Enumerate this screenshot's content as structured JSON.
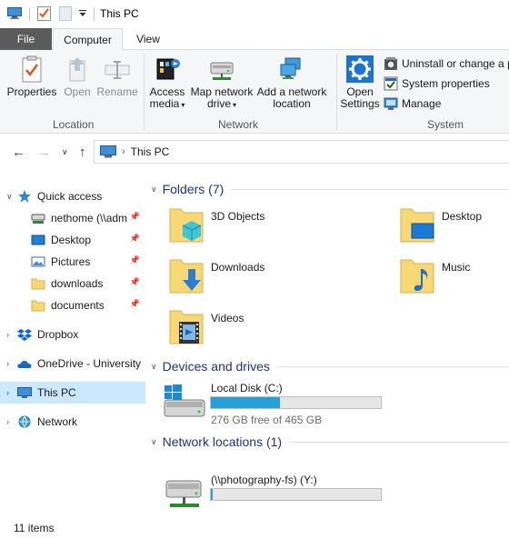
{
  "window": {
    "title": "This PC"
  },
  "ribbon_tabs": {
    "file": "File",
    "computer": "Computer",
    "view": "View"
  },
  "ribbon": {
    "location": {
      "label": "Location",
      "properties": "Properties",
      "open": "Open",
      "rename": "Rename"
    },
    "network": {
      "label": "Network",
      "access_media": [
        "Access",
        "media"
      ],
      "map_network_drive": [
        "Map network",
        "drive"
      ],
      "add_network_location": [
        "Add a network",
        "location"
      ]
    },
    "system": {
      "label": "System",
      "open_settings": [
        "Open",
        "Settings"
      ],
      "uninstall": "Uninstall or change a p",
      "system_properties": "System properties",
      "manage": "Manage"
    }
  },
  "address": {
    "path": "This PC",
    "separator": "›"
  },
  "nav_pane": {
    "quick_access": "Quick access",
    "quick_items": [
      {
        "label": "nethome (\\\\adm",
        "icon": "network-drive-icon"
      },
      {
        "label": "Desktop",
        "icon": "desktop-icon"
      },
      {
        "label": "Pictures",
        "icon": "pictures-icon"
      },
      {
        "label": "downloads",
        "icon": "folder-icon"
      },
      {
        "label": "documents",
        "icon": "folder-icon"
      }
    ],
    "dropbox": "Dropbox",
    "onedrive": "OneDrive - University",
    "this_pc": "This PC",
    "network": "Network"
  },
  "content": {
    "folders_header": "Folders (7)",
    "folders": [
      {
        "name": "3D Objects",
        "icon": "3d-objects-icon"
      },
      {
        "name": "Desktop",
        "icon": "desktop-folder-icon"
      },
      {
        "name": "Downloads",
        "icon": "downloads-folder-icon"
      },
      {
        "name": "Music",
        "icon": "music-folder-icon"
      },
      {
        "name": "Videos",
        "icon": "videos-folder-icon"
      }
    ],
    "devices_header": "Devices and drives",
    "drives": [
      {
        "name": "Local Disk (C:)",
        "free": "276 GB free of 465 GB",
        "used_fraction": 0.406
      }
    ],
    "network_header": "Network locations (1)",
    "network_drives": [
      {
        "name": "(\\\\photography-fs) (Y:)",
        "used_fraction": 0.01
      }
    ]
  },
  "status": {
    "items": "11 items"
  },
  "colors": {
    "accent": "#1e3287",
    "selection": "#cce8ff",
    "drive_fill": "#26a0da",
    "folder_yellow": "#f8d775",
    "file_tab": "#5b5b5b"
  }
}
